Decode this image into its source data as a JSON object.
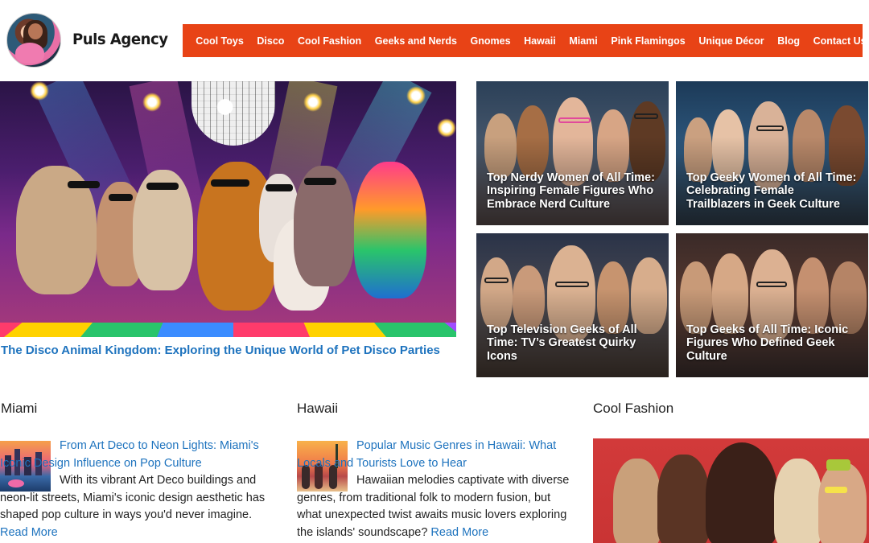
{
  "site": {
    "brand": "Puls Agency"
  },
  "nav": {
    "items": [
      "Cool Toys",
      "Disco",
      "Cool Fashion",
      "Geeks and Nerds",
      "Gnomes",
      "Hawaii",
      "Miami",
      "Pink Flamingos",
      "Unique Décor",
      "Blog",
      "Contact Us"
    ],
    "search_icon": "search-icon",
    "color": "#e84316"
  },
  "hero": {
    "title": "The Disco Animal Kingdom: Exploring the Unique World of Pet Disco Parties"
  },
  "cards": [
    {
      "title": "Top Nerdy Women of All Time: Inspiring Female Figures Who Embrace Nerd Culture"
    },
    {
      "title": "Top Geeky Women of All Time: Celebrating Female Trailblazers in Geek Culture"
    },
    {
      "title": "Top Television Geeks of All Time: TV’s Greatest Quirky Icons"
    },
    {
      "title": "Top Geeks of All Time: Iconic Figures Who Defined Geek Culture"
    }
  ],
  "sections": {
    "miami": {
      "heading": "Miami",
      "post_title": "From Art Deco to Neon Lights: Miami's Iconic Design Influence on Pop Culture",
      "excerpt": "With its vibrant Art Deco buildings and neon-lit streets, Miami's iconic design aesthetic has shaped pop culture in ways you'd never imagine.",
      "read_more": "Read More"
    },
    "hawaii": {
      "heading": "Hawaii",
      "post_title": "Popular Music Genres in Hawaii: What Locals and Tourists Love to Hear",
      "excerpt": "Hawaiian melodies captivate with diverse genres, from traditional folk to modern fusion, but what unexpected twist awaits music lovers exploring the islands' soundscape?",
      "read_more": "Read More"
    },
    "fashion": {
      "heading": "Cool Fashion"
    }
  },
  "link_color": "#1e73be"
}
